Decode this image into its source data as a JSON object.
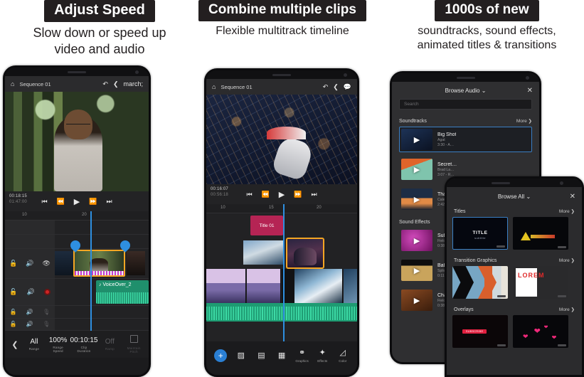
{
  "panels": [
    {
      "pill": "Adjust Speed",
      "sub": "Slow down or speed up\nvideo and audio"
    },
    {
      "pill": "Combine multiple clips",
      "sub": "Flexible multitrack timeline"
    },
    {
      "pill": "1000s of new",
      "sub": "soundtracks, sound effects,\nanimated titles & transitions"
    }
  ],
  "phone1": {
    "appbar": {
      "home_icon": "home-icon",
      "sequence_name": "Sequence 01",
      "undo_icon": "undo-icon",
      "share_icon": "share-icon",
      "comment_icon": "comment-icon"
    },
    "transport": {
      "current_time": "00:18:15",
      "total_time": "01:47:00",
      "buttons": [
        "skip-start-icon",
        "step-back-icon",
        "play-icon",
        "step-forward-icon",
        "skip-end-icon"
      ]
    },
    "ruler_ticks": [
      "10",
      "20"
    ],
    "tracks": [
      {
        "lock": "unlock-icon",
        "audio": "speaker-icon",
        "extra": "eye-icon",
        "dim": false
      },
      {
        "lock": "unlock-icon",
        "audio": "speaker-icon",
        "extra": "record-icon",
        "dim": false
      },
      {
        "lock": "unlock-icon",
        "audio": "speaker-icon",
        "extra": "mic-icon",
        "dim": true
      },
      {
        "lock": "unlock-icon",
        "audio": "speaker-icon",
        "extra": "mic-icon",
        "dim": true
      }
    ],
    "voiceover_clip": {
      "label": "♪ VoiceOver_2",
      "color": "#25b184"
    },
    "selected_clip_color": "#f5a623",
    "speedbar": {
      "back_icon": "chevron-left-icon",
      "cells": [
        {
          "value": "All",
          "label": "Range",
          "dim": false
        },
        {
          "value": "100%",
          "label": "Range\nSpeed",
          "dim": false
        },
        {
          "value": "00:10:15",
          "label": "Clip\nDuration",
          "dim": false
        },
        {
          "value": "Off",
          "label": "Ramp",
          "dim": true
        },
        {
          "value": "",
          "label": "Maintain\nPitch",
          "dim": true,
          "checkbox": true
        }
      ]
    }
  },
  "phone2": {
    "appbar": {
      "home_icon": "home-icon",
      "sequence_name": "Sequence 01",
      "undo_icon": "undo-icon",
      "share_icon": "share-icon",
      "comment_icon": "comment-icon"
    },
    "transport": {
      "current_time": "00:16:07",
      "total_time": "00:56:18",
      "buttons": [
        "skip-start-icon",
        "step-back-icon",
        "play-icon",
        "step-forward-icon",
        "skip-end-icon"
      ]
    },
    "ruler_ticks": [
      "10",
      "15",
      "20"
    ],
    "title_clip": {
      "label": "Title 01",
      "color": "#b52454"
    },
    "toolbar": {
      "add_label": "+",
      "items": [
        {
          "icon": "add-media-icon",
          "label": ""
        },
        {
          "icon": "crop-icon",
          "label": ""
        },
        {
          "icon": "align-icon",
          "label": ""
        },
        {
          "icon": "layers-icon",
          "label": ""
        },
        {
          "icon": "graphics-icon",
          "label": "Graphics"
        },
        {
          "icon": "effects-icon",
          "label": "Effects"
        },
        {
          "icon": "color-icon",
          "label": "Color"
        }
      ]
    }
  },
  "phone3": {
    "header": {
      "title": "Browse Audio",
      "chevron": "chevron-down-icon",
      "close": "close-icon"
    },
    "search": {
      "placeholder": "Search",
      "value": ""
    },
    "sections": [
      {
        "name": "Soundtracks",
        "more": "More",
        "items": [
          {
            "title": "Big Shot",
            "artist": "Agat",
            "meta": "3:30 - A…",
            "selected": true,
            "thumb": "#14213d"
          },
          {
            "title": "Secret…",
            "artist": "Brad La…",
            "meta": "3:07 - R…",
            "selected": false,
            "thumb": "#d4622a"
          },
          {
            "title": "That C…",
            "artist": "Caley Ro…",
            "meta": "2:42 - P…",
            "selected": false,
            "thumb": "#2b4a6b"
          }
        ]
      },
      {
        "name": "Sound Effects",
        "more": "More",
        "items": [
          {
            "title": "Subwe…",
            "artist": "Field an…",
            "meta": "0:38 - Cl…",
            "selected": false,
            "thumb": "#a51f8c"
          },
          {
            "title": "Babbli…",
            "artist": "Splice E…",
            "meta": "0:11 - Na…",
            "selected": false,
            "thumb": "#c09a4e"
          },
          {
            "title": "Chains…",
            "artist": "Field an…",
            "meta": "0:38 - To…",
            "selected": false,
            "thumb": "#7d4323"
          }
        ]
      }
    ]
  },
  "phone4": {
    "header": {
      "title": "Browse All",
      "chevron": "chevron-down-icon",
      "close": "close-icon"
    },
    "sections": [
      {
        "name": "Titles",
        "more": "More",
        "cards": [
          {
            "kind": "title-card",
            "main": "TITLE",
            "sub": "subtitle",
            "selected": true
          },
          {
            "kind": "warning-card",
            "main": "",
            "sub": "",
            "selected": false
          }
        ]
      },
      {
        "name": "Transition Graphics",
        "more": "More",
        "cards": [
          {
            "kind": "chevron-card",
            "main": "",
            "sub": "",
            "selected": false
          },
          {
            "kind": "lorem-card",
            "main": "LOREM",
            "sub": "",
            "selected": false
          }
        ]
      },
      {
        "name": "Overlays",
        "more": "More",
        "cards": [
          {
            "kind": "subscribe-card",
            "main": "SUBSCRIBE",
            "sub": "",
            "selected": false
          },
          {
            "kind": "hearts-card",
            "main": "",
            "sub": "",
            "selected": false
          }
        ]
      }
    ]
  },
  "colors": {
    "accent_blue": "#2e8fe0",
    "selected_orange": "#f5a623",
    "audio_green": "#25b184",
    "title_magenta": "#b52454",
    "record_red": "#cf2525"
  }
}
